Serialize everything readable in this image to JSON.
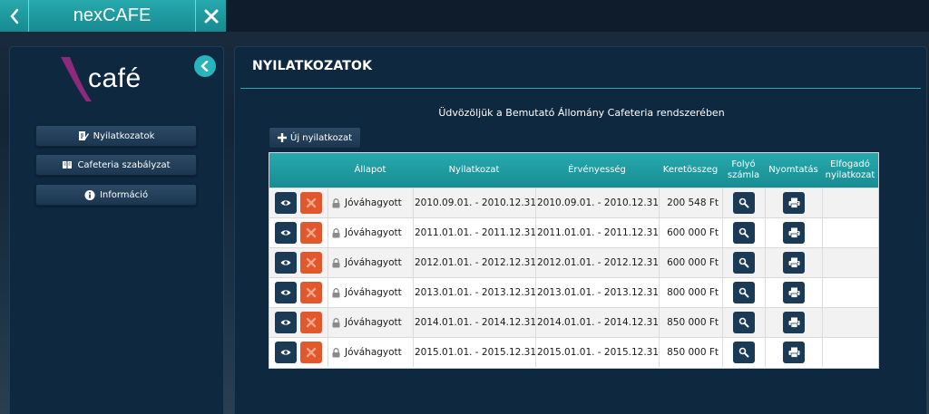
{
  "app": {
    "title": "nexCAFE"
  },
  "logo": {
    "text": "café"
  },
  "sidebar": {
    "items": [
      {
        "label": "Nyilatkozatok",
        "icon": "edit-document-icon"
      },
      {
        "label": "Cafeteria szabályzat",
        "icon": "book-icon"
      },
      {
        "label": "Információ",
        "icon": "info-icon"
      }
    ]
  },
  "main": {
    "title": "NYILATKOZATOK",
    "welcome": "Üdvözöljük a Bemutató Állomány Cafeteria rendszerében",
    "new_button": "Új nyilatkozat"
  },
  "table": {
    "headers": {
      "status": "Állapot",
      "declaration": "Nyilatkozat",
      "validity": "Érvényesség",
      "amount": "Keretösszeg",
      "account_l1": "Folyó",
      "account_l2": "számla",
      "print": "Nyomtatás",
      "accepted_l1": "Elfogadó",
      "accepted_l2": "nyilatkozat"
    },
    "rows": [
      {
        "status": "Jóváhagyott",
        "declaration": "2010.09.01. - 2010.12.31.",
        "validity": "2010.09.01. - 2010.12.31.",
        "amount": "200 548 Ft"
      },
      {
        "status": "Jóváhagyott",
        "declaration": "2011.01.01. - 2011.12.31.",
        "validity": "2011.01.01. - 2011.12.31.",
        "amount": "600 000 Ft"
      },
      {
        "status": "Jóváhagyott",
        "declaration": "2012.01.01. - 2012.12.31.",
        "validity": "2012.01.01. - 2012.12.31.",
        "amount": "600 000 Ft"
      },
      {
        "status": "Jóváhagyott",
        "declaration": "2013.01.01. - 2013.12.31.",
        "validity": "2013.01.01. - 2013.12.31.",
        "amount": "800 000 Ft"
      },
      {
        "status": "Jóváhagyott",
        "declaration": "2014.01.01. - 2014.12.31.",
        "validity": "2014.01.01. - 2014.12.31.",
        "amount": "850 000 Ft"
      },
      {
        "status": "Jóváhagyott",
        "declaration": "2015.01.01. - 2015.12.31.",
        "validity": "2015.01.01. - 2015.12.31.",
        "amount": "850 000 Ft"
      }
    ]
  },
  "colors": {
    "accent": "#27a9ad",
    "panel": "#0e2840",
    "delete": "#e2582d",
    "action": "#1b3a55"
  }
}
